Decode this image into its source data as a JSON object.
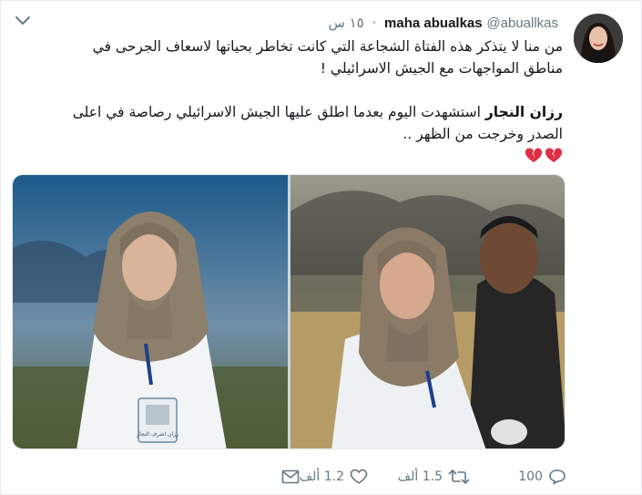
{
  "user": {
    "display_name": "maha abualkas",
    "handle": "@abuallkas",
    "time": "١٥ س",
    "separator": "·"
  },
  "tweet": {
    "line1": "من منا لا يتذكر هذه الفتاة الشجاعة التي كانت تخاطر بحياتها لاسعاف الجرحى في",
    "line2": "مناطق المواجهات مع الجيش الاسرائيلي !",
    "line3_bold": "رزان النجار",
    "line3_rest": " استشهدت اليوم بعدما اطلق عليها الجيش الاسرائيلي  رصاصة في اعلى",
    "line4": "الصدر وخرجت من الظهر .."
  },
  "media": {
    "badge_left": "رزان اشرف النجار"
  },
  "actions": {
    "replies": "100",
    "retweets": "1.5 ألف",
    "likes": "1.2 ألف"
  },
  "icons": {
    "broken_heart": "broken-heart-emoji",
    "more": "chevron-down-icon",
    "reply": "reply-icon",
    "retweet": "retweet-icon",
    "like": "heart-icon",
    "dm": "envelope-icon"
  },
  "colors": {
    "text": "#14171a",
    "secondary": "#657786",
    "heart": "#dd2e44"
  }
}
